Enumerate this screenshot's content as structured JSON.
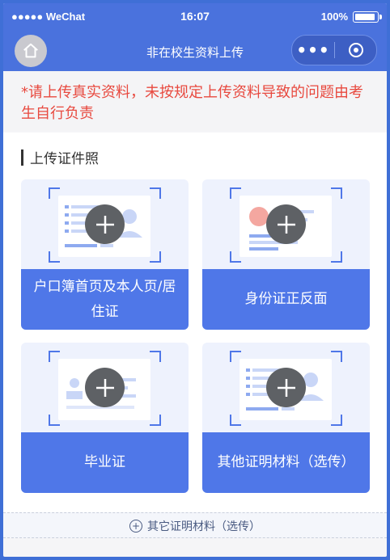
{
  "status_bar": {
    "carrier": "●●●●● WeChat",
    "time": "16:07",
    "battery": "100%"
  },
  "navbar": {
    "title": "非在校生资料上传"
  },
  "notice": {
    "text": "*请上传真实资料，未按规定上传资料导致的问题由考生自行负责"
  },
  "section": {
    "title": "上传证件照"
  },
  "cards": [
    {
      "label": "户口簿首页及本人页/居住证"
    },
    {
      "label": "身份证正反面"
    },
    {
      "label": "毕业证"
    },
    {
      "label": "其他证明材料（选传）"
    }
  ],
  "footer": {
    "label": "其它证明材料（选传）"
  },
  "colors": {
    "accent": "#4a72dd",
    "notice": "#e8493f",
    "card_caption": "#4f77e8"
  }
}
